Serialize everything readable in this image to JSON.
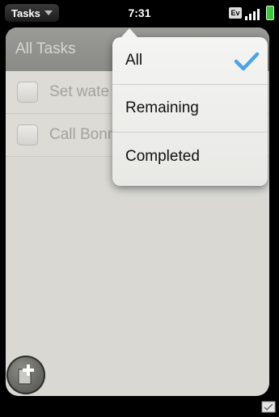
{
  "status_bar": {
    "app_name": "Tasks",
    "time": "7:31",
    "network_badge": "Ev"
  },
  "header": {
    "title": "All Tasks"
  },
  "tasks": [
    {
      "label": "Set wate",
      "checked": false
    },
    {
      "label": "Call Bonn",
      "checked": false
    }
  ],
  "filter_menu": {
    "items": [
      {
        "label": "All",
        "selected": true
      },
      {
        "label": "Remaining",
        "selected": false
      },
      {
        "label": "Completed",
        "selected": false
      }
    ]
  },
  "icons": {
    "add": "add-task-icon",
    "check": "checkmark-icon",
    "notification": "notification-icon"
  },
  "colors": {
    "accent_check": "#4da3e6",
    "battery": "#3fc43f",
    "card_background": "#d9d8d3",
    "header_background": "#8f8f8b"
  }
}
